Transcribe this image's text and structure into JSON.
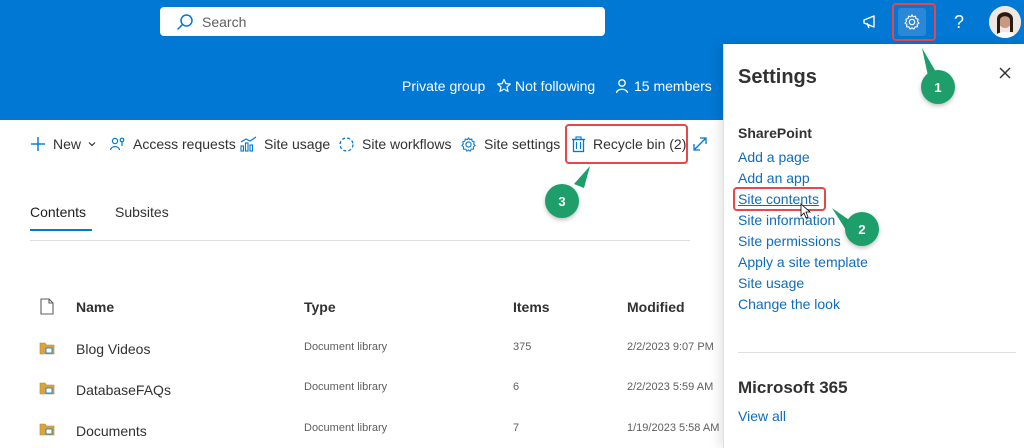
{
  "suite": {
    "search_placeholder": "Search",
    "icons": [
      "megaphone-icon",
      "gear-icon",
      "help-icon"
    ],
    "help_glyph": "?"
  },
  "site": {
    "privacy": "Private group",
    "follow_label": "Not following",
    "members_label": "15 members"
  },
  "command_bar": {
    "new_label": "New",
    "access_requests": "Access requests",
    "site_usage": "Site usage",
    "site_workflows": "Site workflows",
    "site_settings": "Site settings",
    "recycle_bin": "Recycle bin (2)"
  },
  "tabs": [
    {
      "label": "Contents",
      "active": true
    },
    {
      "label": "Subsites",
      "active": false
    }
  ],
  "table": {
    "headers": [
      "Name",
      "Type",
      "Items",
      "Modified"
    ],
    "rows": [
      {
        "name": "Blog Videos",
        "type": "Document library",
        "items": "375",
        "modified": "2/2/2023 9:07 PM"
      },
      {
        "name": "DatabaseFAQs",
        "type": "Document library",
        "items": "6",
        "modified": "2/2/2023 5:59 AM"
      },
      {
        "name": "Documents",
        "type": "Document library",
        "items": "7",
        "modified": "1/19/2023 5:58 AM"
      }
    ]
  },
  "settings_panel": {
    "title": "Settings",
    "section_sharepoint": "SharePoint",
    "links": [
      "Add a page",
      "Add an app",
      "Site contents",
      "Site information",
      "Site permissions",
      "Apply a site template",
      "Site usage",
      "Change the look"
    ],
    "section_m365": "Microsoft 365",
    "view_all": "View all"
  },
  "annotations": {
    "step1": "1",
    "step2": "2",
    "step3": "3",
    "highlight_color": "#e8474a",
    "badge_color": "#1e9e6b"
  },
  "colors": {
    "brand": "#0078d4",
    "link": "#0f6cbd"
  }
}
